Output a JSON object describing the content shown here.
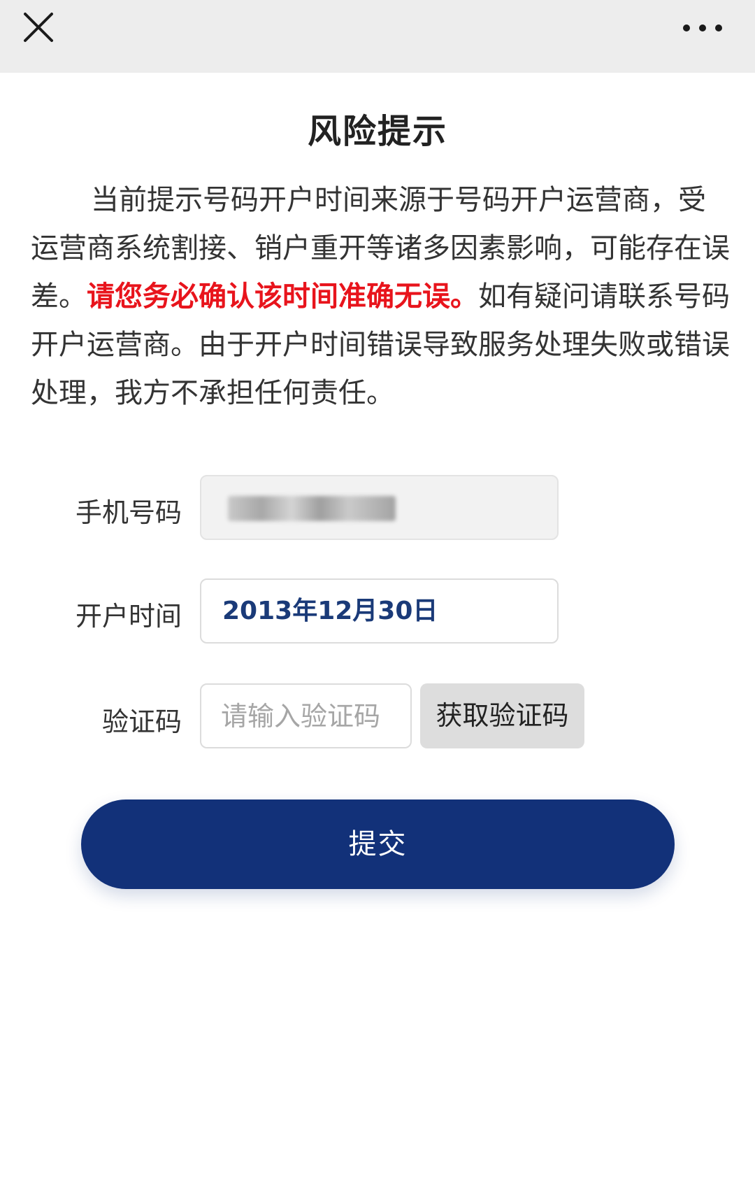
{
  "topbar": {
    "close_icon": "close-icon",
    "more_icon": "more-horizontal-icon"
  },
  "page": {
    "title": "风险提示",
    "notice": {
      "before": "当前提示号码开户时间来源于号码开户运营商，受运营商系统割接、销户重开等诸多因素影响，可能存在误差。",
      "warning": "请您务必确认该时间准确无误。",
      "after": "如有疑问请联系号码开户运营商。由于开户时间错误导致服务处理失败或错误处理，我方不承担任何责任。"
    }
  },
  "form": {
    "phone_label": "手机号码",
    "open_time_label": "开户时间",
    "open_time_value": "2013年12月30日",
    "code_label": "验证码",
    "code_placeholder": "请输入验证码",
    "get_code_label": "获取验证码",
    "submit_label": "提交"
  },
  "colors": {
    "warning": "#e8141c",
    "primary": "#123179",
    "date_text": "#1a3a78"
  }
}
